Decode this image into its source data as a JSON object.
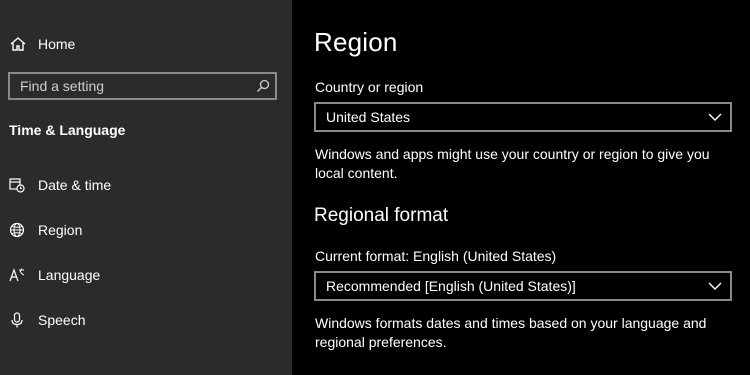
{
  "sidebar": {
    "home_label": "Home",
    "search_placeholder": "Find a setting",
    "section_title": "Time & Language",
    "items": [
      {
        "label": "Date & time",
        "icon": "calendar-clock-icon"
      },
      {
        "label": "Region",
        "icon": "globe-icon"
      },
      {
        "label": "Language",
        "icon": "language-icon"
      },
      {
        "label": "Speech",
        "icon": "microphone-icon"
      }
    ]
  },
  "main": {
    "title": "Region",
    "country_label": "Country or region",
    "country_value": "United States",
    "country_desc": "Windows and apps might use your country or region to give you local content.",
    "format_heading": "Regional format",
    "format_current_label": "Current format: English (United States)",
    "format_value": "Recommended [English (United States)]",
    "format_desc": "Windows formats dates and times based on your language and regional preferences."
  },
  "colors": {
    "sidebar_bg": "#2b2b2b",
    "main_bg": "#000000",
    "border": "#8a8a8a",
    "text": "#ffffff"
  }
}
